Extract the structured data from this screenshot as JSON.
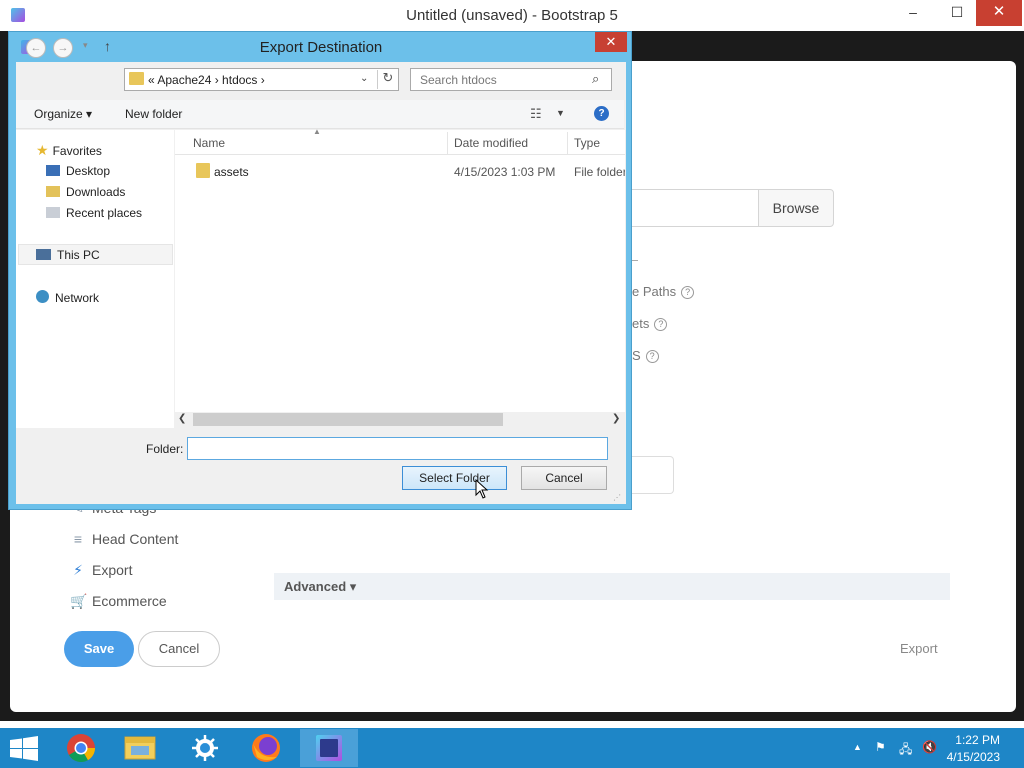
{
  "app": {
    "title": "Untitled (unsaved) - Bootstrap 5",
    "controls": {
      "minimize": "–",
      "maximize": "☐",
      "close": "✕"
    }
  },
  "background_modal": {
    "browse_button": "Browse",
    "options": [
      {
        "label": "e Paths"
      },
      {
        "label": "ets"
      },
      {
        "label": "S"
      }
    ],
    "help_glyph": "?",
    "sidebar_items": [
      {
        "label": "Meta Tags",
        "icon": "tag-icon"
      },
      {
        "label": "Head Content",
        "icon": "lines-icon"
      },
      {
        "label": "Export",
        "icon": "bolt-icon"
      },
      {
        "label": "Ecommerce",
        "icon": "cart-icon"
      }
    ],
    "advanced_label": "Advanced",
    "save_label": "Save",
    "cancel_label": "Cancel",
    "export_label": "Export"
  },
  "dialog": {
    "title": "Export Destination",
    "close_glyph": "✕",
    "address": {
      "path": "«  Apache24  ›  htdocs  ›"
    },
    "search_placeholder": "Search htdocs",
    "toolbar": {
      "organize": "Organize ▾",
      "new_folder": "New folder"
    },
    "nav_pane": {
      "favorites": "Favorites",
      "desktop": "Desktop",
      "downloads": "Downloads",
      "recent_places": "Recent places",
      "this_pc": "This PC",
      "network": "Network"
    },
    "columns": {
      "name": "Name",
      "date_modified": "Date modified",
      "type": "Type"
    },
    "files": [
      {
        "name": "assets",
        "date": "4/15/2023 1:03 PM",
        "type": "File folder"
      }
    ],
    "folder_label": "Folder:",
    "folder_value": "",
    "select_button": "Select Folder",
    "cancel_button": "Cancel"
  },
  "taskbar": {
    "apps": [
      "chrome-icon",
      "file-explorer-icon",
      "settings-icon",
      "firefox-icon",
      "bootstrap-studio-icon"
    ],
    "time": "1:22 PM",
    "date": "4/15/2023"
  },
  "colors": {
    "dialog_frame": "#6cc0ea",
    "taskbar": "#1e86c7",
    "close_red": "#c74033",
    "save_blue": "#4a9ee8"
  }
}
